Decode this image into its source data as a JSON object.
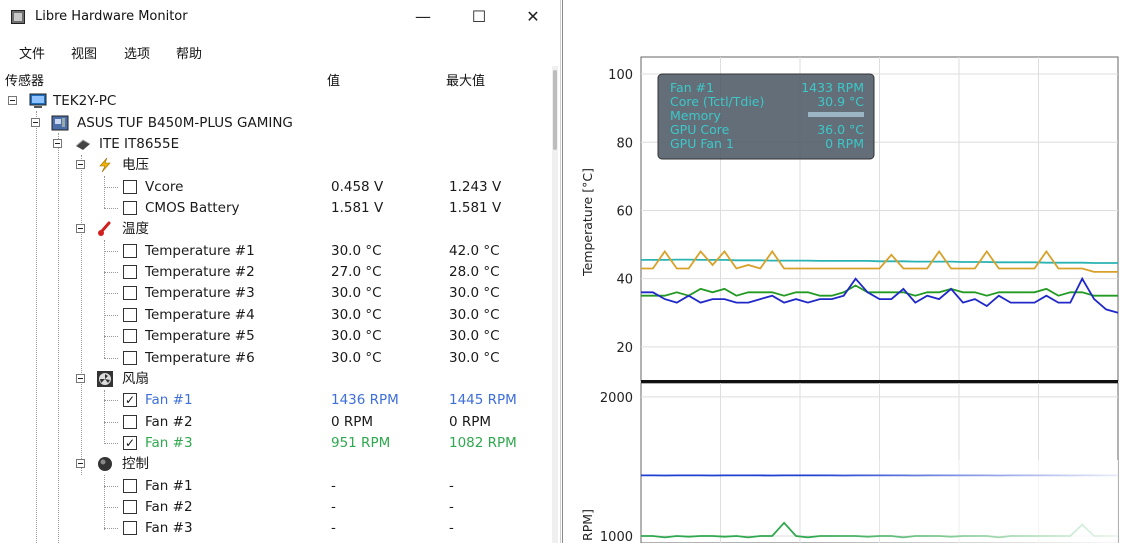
{
  "window": {
    "title": "Libre Hardware Monitor",
    "minimize": "—",
    "maximize": "☐",
    "close": "✕"
  },
  "menu": [
    "文件",
    "视图",
    "选项",
    "帮助"
  ],
  "columns": {
    "sensor": "传感器",
    "value": "值",
    "max": "最大值"
  },
  "tree": {
    "computer": "TEK2Y-PC",
    "mainboard": "ASUS TUF B450M-PLUS GAMING",
    "chip": "ITE IT8655E",
    "voltage_group": "电压",
    "temperature_group": "温度",
    "fan_group": "风扇",
    "control_group": "控制",
    "voltages": [
      {
        "name": "Vcore",
        "value": "0.458 V",
        "max": "1.243 V"
      },
      {
        "name": "CMOS Battery",
        "value": "1.581 V",
        "max": "1.581 V"
      }
    ],
    "temperatures": [
      {
        "name": "Temperature #1",
        "value": "30.0 °C",
        "max": "42.0 °C"
      },
      {
        "name": "Temperature #2",
        "value": "27.0 °C",
        "max": "28.0 °C"
      },
      {
        "name": "Temperature #3",
        "value": "30.0 °C",
        "max": "30.0 °C"
      },
      {
        "name": "Temperature #4",
        "value": "30.0 °C",
        "max": "30.0 °C"
      },
      {
        "name": "Temperature #5",
        "value": "30.0 °C",
        "max": "30.0 °C"
      },
      {
        "name": "Temperature #6",
        "value": "30.0 °C",
        "max": "30.0 °C"
      }
    ],
    "fans": [
      {
        "name": "Fan #1",
        "value": "1436 RPM",
        "max": "1445 RPM",
        "checked": true,
        "color": "#3f6fd8"
      },
      {
        "name": "Fan #2",
        "value": "0 RPM",
        "max": "0 RPM",
        "checked": false,
        "color": "#1a1a1a"
      },
      {
        "name": "Fan #3",
        "value": "951 RPM",
        "max": "1082 RPM",
        "checked": true,
        "color": "#2fa84f"
      }
    ],
    "controls": [
      {
        "name": "Fan #1",
        "value": "-",
        "max": "-"
      },
      {
        "name": "Fan #2",
        "value": "-",
        "max": "-"
      },
      {
        "name": "Fan #3",
        "value": "-",
        "max": "-"
      }
    ]
  },
  "chart_data": [
    {
      "type": "line",
      "ylabel": "Temperature [°C]",
      "ylim": [
        10,
        105
      ],
      "yticks": [
        20,
        40,
        60,
        80,
        100
      ],
      "grid": true,
      "legend": {
        "placement": "top-left",
        "entries": [
          {
            "name": "Fan #1",
            "value": "1433 RPM",
            "color": "#3cc8c8"
          },
          {
            "name": "Core (Tctl/Tdie)",
            "value": "30.9 °C",
            "color": "#3cc8c8"
          },
          {
            "name": "Memory",
            "value": "",
            "color": "#3cc8c8"
          },
          {
            "name": "GPU Core",
            "value": "36.0 °C",
            "color": "#3cc8c8"
          },
          {
            "name": "GPU Fan 1",
            "value": "0 RPM",
            "color": "#3cc8c8"
          }
        ]
      },
      "x": [
        0,
        1,
        2,
        3,
        4,
        5,
        6,
        7,
        8,
        9,
        10,
        11,
        12,
        13,
        14,
        15,
        16,
        17,
        18,
        19,
        20,
        21,
        22,
        23,
        24,
        25,
        26,
        27,
        28,
        29,
        30,
        31,
        32,
        33,
        34,
        35,
        36,
        37,
        38,
        39,
        40
      ],
      "series": [
        {
          "color": "#2ab3b3",
          "values": [
            45.5,
            45.5,
            45.5,
            45.6,
            45.6,
            45.5,
            45.5,
            45.5,
            45.4,
            45.4,
            45.4,
            45.3,
            45.3,
            45.3,
            45.3,
            45.2,
            45.2,
            45.2,
            45.2,
            45.2,
            45.1,
            45.1,
            45.1,
            45.0,
            45.0,
            45.0,
            45.0,
            44.9,
            44.9,
            44.9,
            44.8,
            44.8,
            44.8,
            44.8,
            44.7,
            44.7,
            44.7,
            44.7,
            44.6,
            44.6,
            44.6
          ]
        },
        {
          "color": "#d8a12a",
          "values": [
            43,
            43,
            48,
            43,
            43,
            48,
            44,
            48,
            43,
            44,
            43,
            48,
            43,
            43,
            43,
            43,
            43,
            43,
            43,
            43,
            43,
            47,
            43,
            43,
            43,
            48,
            43,
            43,
            43,
            48,
            43,
            43,
            43,
            43,
            48,
            43,
            43,
            43,
            42,
            42,
            42
          ]
        },
        {
          "color": "#239a23",
          "values": [
            35,
            35,
            35,
            36,
            35,
            37,
            36,
            37,
            35,
            36,
            36,
            36,
            35,
            36,
            36,
            35,
            35,
            36,
            38,
            36,
            36,
            36,
            36,
            35,
            36,
            36,
            37,
            36,
            36,
            35,
            36,
            36,
            36,
            36,
            37,
            35,
            36,
            36,
            35,
            35,
            35
          ]
        },
        {
          "color": "#2028c8",
          "values": [
            36,
            36,
            34,
            33,
            35,
            33,
            34,
            34,
            33,
            33,
            34,
            35,
            33,
            34,
            33,
            34,
            34,
            35,
            40,
            36,
            34,
            34,
            37,
            33,
            35,
            34,
            37,
            33,
            34,
            32,
            35,
            33,
            33,
            33,
            35,
            33,
            33,
            40,
            34,
            31,
            30
          ]
        }
      ]
    },
    {
      "type": "line",
      "ylabel": "RPM]",
      "ylim": [
        950,
        2100
      ],
      "yticks": [
        1000,
        2000
      ],
      "grid": true,
      "x": [
        0,
        1,
        2,
        3,
        4,
        5,
        6,
        7,
        8,
        9,
        10,
        11,
        12,
        13,
        14,
        15,
        16,
        17,
        18,
        19,
        20,
        21,
        22,
        23,
        24,
        25,
        26,
        27,
        28,
        29,
        30,
        31,
        32,
        33,
        34,
        35,
        36,
        37,
        38,
        39,
        40
      ],
      "series": [
        {
          "color": "#2040d0",
          "values": [
            1436,
            1436,
            1435,
            1436,
            1436,
            1436,
            1435,
            1436,
            1436,
            1436,
            1436,
            1435,
            1436,
            1436,
            1436,
            1436,
            1436,
            1435,
            1436,
            1436,
            1436,
            1436,
            1436,
            1435,
            1436,
            1436,
            1436,
            1436,
            1436,
            1436,
            1435,
            1436,
            1436,
            1436,
            1436,
            1436,
            1435,
            1436,
            1436,
            1436,
            1436
          ]
        },
        {
          "color": "#2fa84f",
          "values": [
            1000,
            1000,
            990,
            1000,
            995,
            1000,
            1000,
            995,
            1000,
            990,
            1000,
            1000,
            1095,
            1000,
            990,
            1000,
            1000,
            1000,
            1000,
            995,
            1000,
            1000,
            990,
            1000,
            1000,
            1000,
            995,
            1000,
            1000,
            1000,
            990,
            1000,
            1000,
            1000,
            1000,
            1000,
            1000,
            1082,
            1000,
            1000,
            1000
          ]
        }
      ]
    }
  ]
}
